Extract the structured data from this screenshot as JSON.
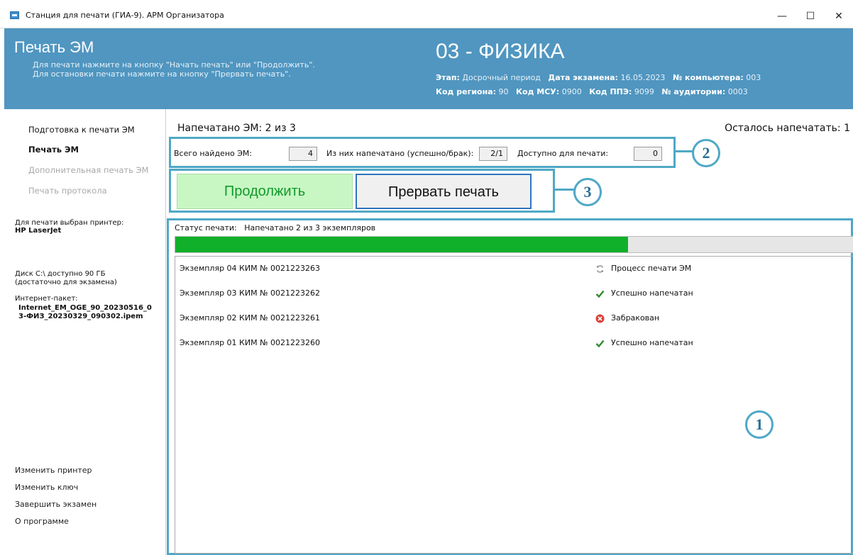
{
  "window": {
    "title": "Станция для печати (ГИА-9). АРМ Организатора",
    "minimize": "—",
    "maximize": "☐",
    "close": "✕"
  },
  "header": {
    "title": "Печать ЭМ",
    "hint_line1": "Для печати нажмите на кнопку \"Начать печать\" или \"Продолжить\".",
    "hint_line2": "Для остановки печати нажмите на кнопку \"Прервать печать\".",
    "subject": "03 - ФИЗИКА",
    "stage_label": "Этап:",
    "stage_value": "Досрочный период",
    "exam_date_label": "Дата экзамена:",
    "exam_date_value": "16.05.2023",
    "computer_label": "№ компьютера:",
    "computer_value": "003",
    "region_label": "Код региона:",
    "region_value": "90",
    "msu_label": "Код МСУ:",
    "msu_value": "0900",
    "ppe_label": "Код ППЭ:",
    "ppe_value": "9099",
    "room_label": "№ аудитории:",
    "room_value": "0003"
  },
  "sidebar": {
    "nav": [
      {
        "label": "Подготовка к печати ЭМ",
        "state": "normal"
      },
      {
        "label": "Печать ЭМ",
        "state": "active"
      },
      {
        "label": "Дополнительная печать ЭМ",
        "state": "disabled"
      },
      {
        "label": "Печать протокола",
        "state": "disabled"
      }
    ],
    "printer_label": "Для печати выбран принтер:",
    "printer_value": "HP LaserJet",
    "disk_line1": "Диск C:\\ доступно 90 ГБ",
    "disk_line2": "(достаточно для экзамена)",
    "package_label": "Интернет-пакет:",
    "package_line1": "Internet_EM_OGE_90_20230516_0",
    "package_line2": "3-ФИЗ_20230329_090302.ipem",
    "links": [
      "Изменить принтер",
      "Изменить ключ",
      "Завершить экзамен",
      "О программе"
    ]
  },
  "main": {
    "printed_text": "Напечатано ЭМ:  2  из  3",
    "remaining_text": "Осталось напечатать:  1",
    "stats": {
      "found_label": "Всего найдено ЭМ:",
      "found_value": "4",
      "printed_label": "Из них напечатано (успешно/брак):",
      "printed_value": "2/1",
      "available_label": "Доступно для печати:",
      "available_value": "0"
    },
    "buttons": {
      "continue": "Продолжить",
      "stop": "Прервать печать"
    },
    "status_label": "Статус печати:",
    "status_value": "Напечатано 2 из 3 экземпляров",
    "progress_fraction": 0.667,
    "rows": [
      {
        "item": "Экземпляр 04  КИМ № 0021223263",
        "status": "Процесс печати ЭМ",
        "icon": "refresh-icon"
      },
      {
        "item": "Экземпляр 03  КИМ № 0021223262",
        "status": "Успешно напечатан",
        "icon": "checkmark-icon"
      },
      {
        "item": "Экземпляр 02  КИМ № 0021223261",
        "status": "Забракован",
        "icon": "error-icon"
      },
      {
        "item": "Экземпляр 01  КИМ № 0021223260",
        "status": "Успешно напечатан",
        "icon": "checkmark-icon"
      }
    ]
  },
  "callouts": [
    "1",
    "2",
    "3"
  ],
  "colors": {
    "header_bg": "#5096c0",
    "accent_border": "#4fa8c6",
    "progress_fill": "#11b02a",
    "continue_bg": "#c8f7c4",
    "continue_text": "#119a2a"
  }
}
